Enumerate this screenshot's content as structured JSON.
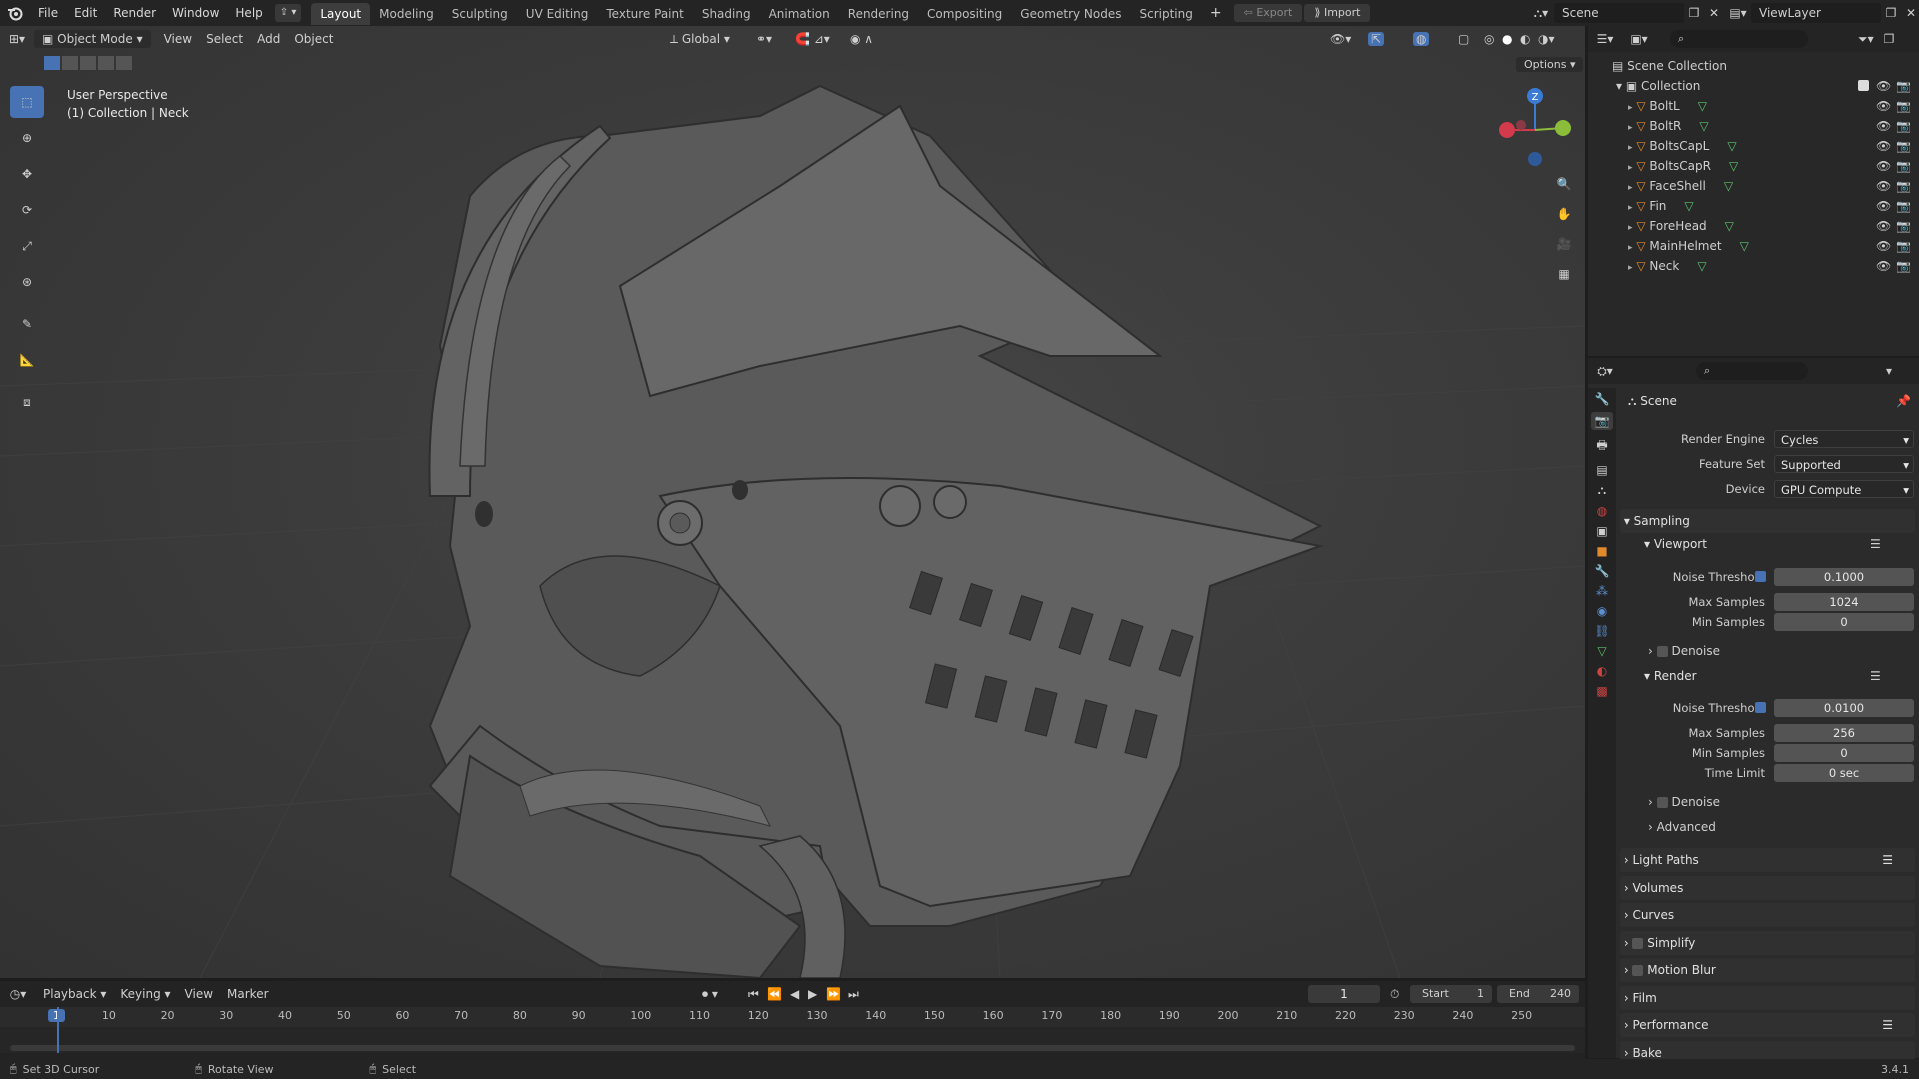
{
  "topbar": {
    "menus": [
      "File",
      "Edit",
      "Render",
      "Window",
      "Help"
    ],
    "workspaces": [
      "Layout",
      "Modeling",
      "Sculpting",
      "UV Editing",
      "Texture Paint",
      "Shading",
      "Animation",
      "Rendering",
      "Compositing",
      "Geometry Nodes",
      "Scripting"
    ],
    "active_workspace": "Layout",
    "export_label": "Export",
    "import_label": "Import",
    "scene_name": "Scene",
    "view_layer": "ViewLayer"
  },
  "viewport": {
    "mode": "Object Mode",
    "menus": [
      "View",
      "Select",
      "Add",
      "Object"
    ],
    "orientation": "Global",
    "options_label": "Options",
    "overlay_line1": "User Perspective",
    "overlay_line2": "(1) Collection | Neck",
    "gizmo_axis": "Z"
  },
  "outliner": {
    "root": "Scene Collection",
    "collection": "Collection",
    "objects": [
      "BoltL",
      "BoltR",
      "BoltsCapL",
      "BoltsCapR",
      "FaceShell",
      "Fin",
      "ForeHead",
      "MainHelmet",
      "Neck"
    ]
  },
  "properties": {
    "context": "Scene",
    "render_engine_label": "Render Engine",
    "render_engine": "Cycles",
    "feature_set_label": "Feature Set",
    "feature_set": "Supported",
    "device_label": "Device",
    "device": "GPU Compute",
    "sampling": "Sampling",
    "viewport": "Viewport",
    "noise_threshold_label": "Noise Threshold",
    "vp_noise": "0.1000",
    "max_samples_label": "Max Samples",
    "vp_max": "1024",
    "min_samples_label": "Min Samples",
    "vp_min": "0",
    "denoise": "Denoise",
    "render": "Render",
    "r_noise": "0.0100",
    "r_max": "256",
    "r_min": "0",
    "time_limit_label": "Time Limit",
    "r_time": "0 sec",
    "advanced": "Advanced",
    "panels": [
      "Light Paths",
      "Volumes",
      "Curves",
      "Simplify",
      "Motion Blur",
      "Film",
      "Performance",
      "Bake"
    ]
  },
  "timeline": {
    "menus": [
      "Playback",
      "Keying",
      "View",
      "Marker"
    ],
    "current_frame": "1",
    "start_label": "Start",
    "start": "1",
    "end_label": "End",
    "end": "240",
    "ticks": [
      "1",
      "10",
      "20",
      "30",
      "40",
      "50",
      "60",
      "70",
      "80",
      "90",
      "100",
      "110",
      "120",
      "130",
      "140",
      "150",
      "160",
      "170",
      "180",
      "190",
      "200",
      "210",
      "220",
      "230",
      "240",
      "250"
    ]
  },
  "statusbar": {
    "hint1": "Set 3D Cursor",
    "hint2": "Rotate View",
    "hint3": "Select",
    "version": "3.4.1"
  }
}
